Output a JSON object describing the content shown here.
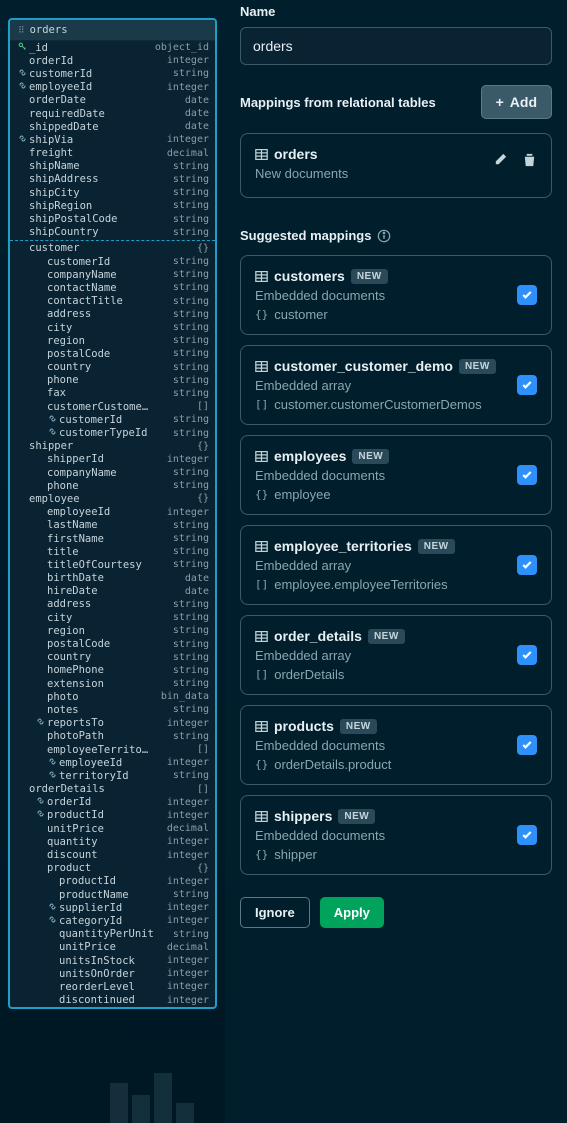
{
  "schema": {
    "tableName": "orders",
    "fields": [
      {
        "icon": "key",
        "name": "_id",
        "type": "object_id",
        "level": 0
      },
      {
        "icon": "",
        "name": "orderId",
        "type": "integer",
        "level": 0
      },
      {
        "icon": "link",
        "name": "customerId",
        "type": "string",
        "level": 0
      },
      {
        "icon": "link",
        "name": "employeeId",
        "type": "integer",
        "level": 0
      },
      {
        "icon": "",
        "name": "orderDate",
        "type": "date",
        "level": 0
      },
      {
        "icon": "",
        "name": "requiredDate",
        "type": "date",
        "level": 0
      },
      {
        "icon": "",
        "name": "shippedDate",
        "type": "date",
        "level": 0
      },
      {
        "icon": "link",
        "name": "shipVia",
        "type": "integer",
        "level": 0
      },
      {
        "icon": "",
        "name": "freight",
        "type": "decimal",
        "level": 0
      },
      {
        "icon": "",
        "name": "shipName",
        "type": "string",
        "level": 0
      },
      {
        "icon": "",
        "name": "shipAddress",
        "type": "string",
        "level": 0
      },
      {
        "icon": "",
        "name": "shipCity",
        "type": "string",
        "level": 0
      },
      {
        "icon": "",
        "name": "shipRegion",
        "type": "string",
        "level": 0
      },
      {
        "icon": "",
        "name": "shipPostalCode",
        "type": "string",
        "level": 0
      },
      {
        "icon": "",
        "name": "shipCountry",
        "type": "string",
        "level": 0
      },
      {
        "sep": true
      },
      {
        "icon": "",
        "name": "customer",
        "type": "{}",
        "level": 0
      },
      {
        "icon": "",
        "name": "customerId",
        "type": "string",
        "level": 1
      },
      {
        "icon": "",
        "name": "companyName",
        "type": "string",
        "level": 1
      },
      {
        "icon": "",
        "name": "contactName",
        "type": "string",
        "level": 1
      },
      {
        "icon": "",
        "name": "contactTitle",
        "type": "string",
        "level": 1
      },
      {
        "icon": "",
        "name": "address",
        "type": "string",
        "level": 1
      },
      {
        "icon": "",
        "name": "city",
        "type": "string",
        "level": 1
      },
      {
        "icon": "",
        "name": "region",
        "type": "string",
        "level": 1
      },
      {
        "icon": "",
        "name": "postalCode",
        "type": "string",
        "level": 1
      },
      {
        "icon": "",
        "name": "country",
        "type": "string",
        "level": 1
      },
      {
        "icon": "",
        "name": "phone",
        "type": "string",
        "level": 1
      },
      {
        "icon": "",
        "name": "fax",
        "type": "string",
        "level": 1
      },
      {
        "icon": "",
        "name": "customerCustome…",
        "type": "[]",
        "level": 1
      },
      {
        "icon": "link",
        "name": "customerId",
        "type": "string",
        "level": 2
      },
      {
        "icon": "link",
        "name": "customerTypeId",
        "type": "string",
        "level": 2
      },
      {
        "icon": "",
        "name": "shipper",
        "type": "{}",
        "level": 0
      },
      {
        "icon": "",
        "name": "shipperId",
        "type": "integer",
        "level": 1
      },
      {
        "icon": "",
        "name": "companyName",
        "type": "string",
        "level": 1
      },
      {
        "icon": "",
        "name": "phone",
        "type": "string",
        "level": 1
      },
      {
        "icon": "",
        "name": "employee",
        "type": "{}",
        "level": 0
      },
      {
        "icon": "",
        "name": "employeeId",
        "type": "integer",
        "level": 1
      },
      {
        "icon": "",
        "name": "lastName",
        "type": "string",
        "level": 1
      },
      {
        "icon": "",
        "name": "firstName",
        "type": "string",
        "level": 1
      },
      {
        "icon": "",
        "name": "title",
        "type": "string",
        "level": 1
      },
      {
        "icon": "",
        "name": "titleOfCourtesy",
        "type": "string",
        "level": 1
      },
      {
        "icon": "",
        "name": "birthDate",
        "type": "date",
        "level": 1
      },
      {
        "icon": "",
        "name": "hireDate",
        "type": "date",
        "level": 1
      },
      {
        "icon": "",
        "name": "address",
        "type": "string",
        "level": 1
      },
      {
        "icon": "",
        "name": "city",
        "type": "string",
        "level": 1
      },
      {
        "icon": "",
        "name": "region",
        "type": "string",
        "level": 1
      },
      {
        "icon": "",
        "name": "postalCode",
        "type": "string",
        "level": 1
      },
      {
        "icon": "",
        "name": "country",
        "type": "string",
        "level": 1
      },
      {
        "icon": "",
        "name": "homePhone",
        "type": "string",
        "level": 1
      },
      {
        "icon": "",
        "name": "extension",
        "type": "string",
        "level": 1
      },
      {
        "icon": "",
        "name": "photo",
        "type": "bin_data",
        "level": 1
      },
      {
        "icon": "",
        "name": "notes",
        "type": "string",
        "level": 1
      },
      {
        "icon": "link",
        "name": "reportsTo",
        "type": "integer",
        "level": 1
      },
      {
        "icon": "",
        "name": "photoPath",
        "type": "string",
        "level": 1
      },
      {
        "icon": "",
        "name": "employeeTerrito…",
        "type": "[]",
        "level": 1
      },
      {
        "icon": "link",
        "name": "employeeId",
        "type": "integer",
        "level": 2
      },
      {
        "icon": "link",
        "name": "territoryId",
        "type": "string",
        "level": 2
      },
      {
        "icon": "",
        "name": "orderDetails",
        "type": "[]",
        "level": 0
      },
      {
        "icon": "link",
        "name": "orderId",
        "type": "integer",
        "level": 1
      },
      {
        "icon": "link",
        "name": "productId",
        "type": "integer",
        "level": 1
      },
      {
        "icon": "",
        "name": "unitPrice",
        "type": "decimal",
        "level": 1
      },
      {
        "icon": "",
        "name": "quantity",
        "type": "integer",
        "level": 1
      },
      {
        "icon": "",
        "name": "discount",
        "type": "integer",
        "level": 1
      },
      {
        "icon": "",
        "name": "product",
        "type": "{}",
        "level": 1
      },
      {
        "icon": "",
        "name": "productId",
        "type": "integer",
        "level": 2
      },
      {
        "icon": "",
        "name": "productName",
        "type": "string",
        "level": 2
      },
      {
        "icon": "link",
        "name": "supplierId",
        "type": "integer",
        "level": 2
      },
      {
        "icon": "link",
        "name": "categoryId",
        "type": "integer",
        "level": 2
      },
      {
        "icon": "",
        "name": "quantityPerUnit",
        "type": "string",
        "level": 2
      },
      {
        "icon": "",
        "name": "unitPrice",
        "type": "decimal",
        "level": 2
      },
      {
        "icon": "",
        "name": "unitsInStock",
        "type": "integer",
        "level": 2
      },
      {
        "icon": "",
        "name": "unitsOnOrder",
        "type": "integer",
        "level": 2
      },
      {
        "icon": "",
        "name": "reorderLevel",
        "type": "integer",
        "level": 2
      },
      {
        "icon": "",
        "name": "discontinued",
        "type": "integer",
        "level": 2
      }
    ]
  },
  "form": {
    "nameLabel": "Name",
    "nameValue": "orders"
  },
  "mappings": {
    "header": "Mappings from relational tables",
    "addLabel": "Add",
    "primary": {
      "name": "orders",
      "sub": "New documents"
    }
  },
  "suggested": {
    "title": "Suggested mappings",
    "items": [
      {
        "name": "customers",
        "badge": "NEW",
        "sub": "Embedded documents",
        "pathIcon": "{}",
        "path": "customer"
      },
      {
        "name": "customer_customer_demo",
        "badge": "NEW",
        "sub": "Embedded array",
        "pathIcon": "[]",
        "path": "customer.customerCustomerDemos"
      },
      {
        "name": "employees",
        "badge": "NEW",
        "sub": "Embedded documents",
        "pathIcon": "{}",
        "path": "employee"
      },
      {
        "name": "employee_territories",
        "badge": "NEW",
        "sub": "Embedded array",
        "pathIcon": "[]",
        "path": "employee.employeeTerritories"
      },
      {
        "name": "order_details",
        "badge": "NEW",
        "sub": "Embedded array",
        "pathIcon": "[]",
        "path": "orderDetails"
      },
      {
        "name": "products",
        "badge": "NEW",
        "sub": "Embedded documents",
        "pathIcon": "{}",
        "path": "orderDetails.product"
      },
      {
        "name": "shippers",
        "badge": "NEW",
        "sub": "Embedded documents",
        "pathIcon": "{}",
        "path": "shipper"
      }
    ]
  },
  "footer": {
    "ignore": "Ignore",
    "apply": "Apply"
  }
}
